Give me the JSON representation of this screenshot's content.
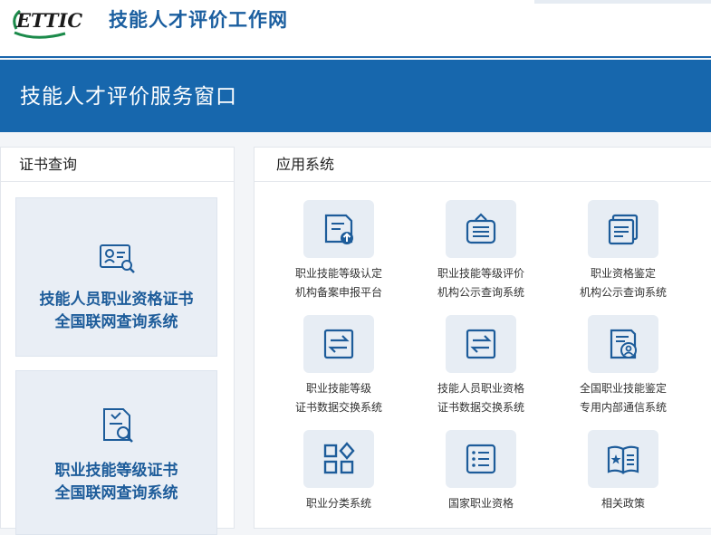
{
  "header": {
    "logo_text": "ETTIC",
    "site_title": "技能人才评价工作网"
  },
  "banner": {
    "title": "技能人才评价服务窗口"
  },
  "cert_panel": {
    "title": "证书查询",
    "cards": [
      {
        "line1": "技能人员职业资格证书",
        "line2": "全国联网查询系统",
        "icon": "certificate-search-icon"
      },
      {
        "line1": "职业技能等级证书",
        "line2": "全国联网查询系统",
        "icon": "document-search-icon"
      }
    ]
  },
  "apps_panel": {
    "title": "应用系统",
    "apps": [
      {
        "line1": "职业技能等级认定",
        "line2": "机构备案申报平台",
        "icon": "upload-document-icon"
      },
      {
        "line1": "职业技能等级评价",
        "line2": "机构公示查询系统",
        "icon": "notice-board-icon"
      },
      {
        "line1": "职业资格鉴定",
        "line2": "机构公示查询系统",
        "icon": "document-list-icon"
      },
      {
        "line1": "职业技能等级",
        "line2": "证书数据交换系统",
        "icon": "exchange-icon"
      },
      {
        "line1": "技能人员职业资格",
        "line2": "证书数据交换系统",
        "icon": "exchange-icon"
      },
      {
        "line1": "全国职业技能鉴定",
        "line2": "专用内部通信系统",
        "icon": "profile-card-icon"
      },
      {
        "line1": "职业分类系统",
        "line2": "",
        "icon": "category-grid-icon"
      },
      {
        "line1": "国家职业资格",
        "line2": "",
        "icon": "list-icon"
      },
      {
        "line1": "相关政策",
        "line2": "",
        "icon": "open-book-icon"
      }
    ]
  },
  "colors": {
    "brand_blue": "#1767ad",
    "link_blue": "#1d5c9a",
    "logo_green": "#1b8a4a"
  }
}
